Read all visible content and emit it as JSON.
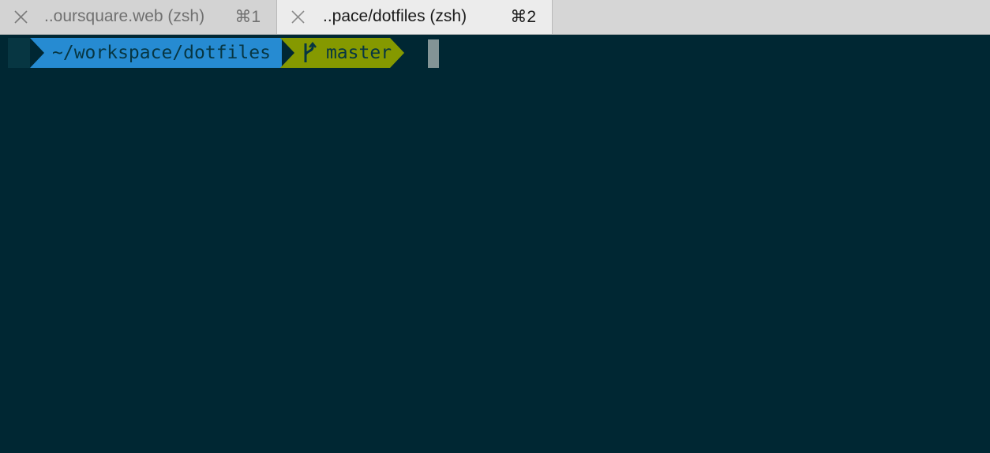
{
  "tabs": [
    {
      "title": "..oursquare.web (zsh)",
      "shortcut": "⌘1",
      "active": false
    },
    {
      "title": "..pace/dotfiles (zsh)",
      "shortcut": "⌘2",
      "active": true
    }
  ],
  "prompt": {
    "directory": "~/workspace/dotfiles",
    "branch": "master",
    "colors": {
      "background": "#002733",
      "dir_segment": "#268bd2",
      "git_segment": "#859900",
      "segment_text": "#073642",
      "cursor": "#839496"
    }
  }
}
